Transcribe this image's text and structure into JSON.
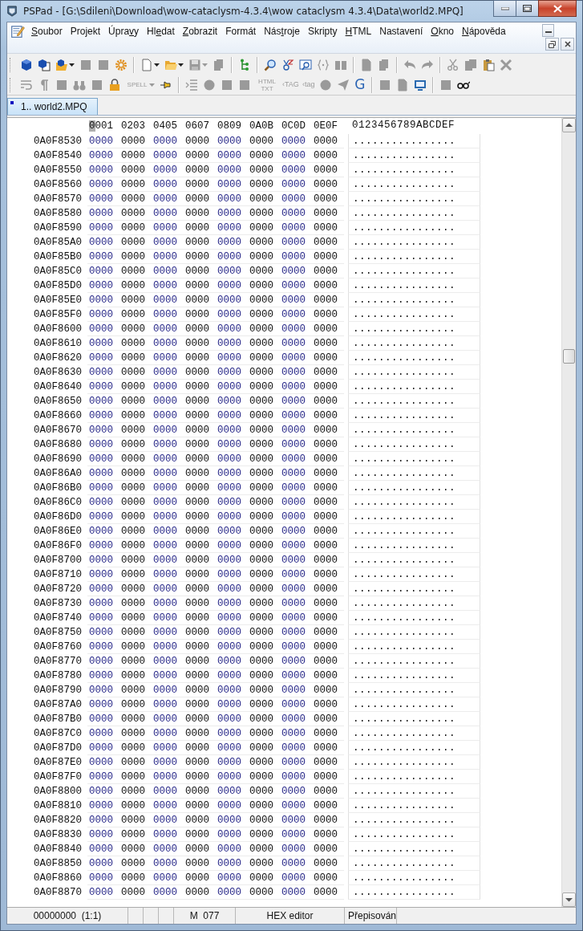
{
  "window": {
    "title": "PSPad - [G:\\Sdileni\\Download\\wow-cataclysm-4.3.4\\wow cataclysm 4.3.4\\Data\\world2.MPQ]"
  },
  "menu": [
    {
      "parts": [
        {
          "text": "S",
          "underlined": true
        },
        {
          "text": "oubor",
          "underlined": false
        }
      ]
    },
    {
      "parts": [
        {
          "text": "Projekt",
          "underlined": false
        }
      ]
    },
    {
      "parts": [
        {
          "text": "Úpra",
          "underlined": false
        },
        {
          "text": "v",
          "underlined": true
        },
        {
          "text": "y",
          "underlined": false
        }
      ]
    },
    {
      "parts": [
        {
          "text": "Hl",
          "underlined": false
        },
        {
          "text": "e",
          "underlined": true
        },
        {
          "text": "dat",
          "underlined": false
        }
      ]
    },
    {
      "parts": [
        {
          "text": "Z",
          "underlined": true
        },
        {
          "text": "obrazit",
          "underlined": false
        }
      ]
    },
    {
      "parts": [
        {
          "text": "Formát",
          "underlined": false
        }
      ]
    },
    {
      "parts": [
        {
          "text": "Nás",
          "underlined": false
        },
        {
          "text": "t",
          "underlined": true
        },
        {
          "text": "roje",
          "underlined": false
        }
      ]
    },
    {
      "parts": [
        {
          "text": "Skripty",
          "underlined": false
        }
      ]
    },
    {
      "parts": [
        {
          "text": "H",
          "underlined": true
        },
        {
          "text": "TML",
          "underlined": false
        }
      ]
    },
    {
      "parts": [
        {
          "text": "Nastavení",
          "underlined": false
        }
      ]
    },
    {
      "parts": [
        {
          "text": "O",
          "underlined": true
        },
        {
          "text": "kno",
          "underlined": false
        }
      ]
    },
    {
      "parts": [
        {
          "text": "N",
          "underlined": true
        },
        {
          "text": "ápověda",
          "underlined": false
        }
      ]
    }
  ],
  "toolbars": [
    [
      {
        "kind": "button",
        "disabled": false
      },
      {
        "kind": "button",
        "disabled": false
      },
      {
        "kind": "dropdown",
        "disabled": false
      },
      {
        "kind": "button",
        "disabled": true
      },
      {
        "kind": "button",
        "disabled": true
      },
      {
        "kind": "button",
        "disabled": false
      },
      {
        "kind": "separator"
      },
      {
        "kind": "dropdown",
        "disabled": false
      },
      {
        "kind": "dropdown",
        "disabled": false
      },
      {
        "kind": "dropdown",
        "disabled": true
      },
      {
        "kind": "button",
        "disabled": true
      },
      {
        "kind": "separator"
      },
      {
        "kind": "button",
        "disabled": false
      },
      {
        "kind": "separator"
      },
      {
        "kind": "button",
        "disabled": false
      },
      {
        "kind": "button",
        "disabled": false
      },
      {
        "kind": "button",
        "disabled": false
      },
      {
        "kind": "button",
        "disabled": true
      },
      {
        "kind": "button",
        "disabled": true
      },
      {
        "kind": "separator"
      },
      {
        "kind": "button",
        "disabled": true
      },
      {
        "kind": "button",
        "disabled": true
      },
      {
        "kind": "separator"
      },
      {
        "kind": "button",
        "disabled": true
      },
      {
        "kind": "button",
        "disabled": true
      },
      {
        "kind": "separator"
      },
      {
        "kind": "button",
        "disabled": true
      },
      {
        "kind": "button",
        "disabled": true
      },
      {
        "kind": "button",
        "disabled": false
      },
      {
        "kind": "button",
        "disabled": true
      }
    ],
    [
      {
        "kind": "button",
        "disabled": true
      },
      {
        "kind": "button",
        "disabled": true
      },
      {
        "kind": "button",
        "disabled": true
      },
      {
        "kind": "button",
        "disabled": true
      },
      {
        "kind": "button",
        "disabled": true
      },
      {
        "kind": "button",
        "disabled": false
      },
      {
        "kind": "text-dropdown",
        "label": "SPELL",
        "disabled": true
      },
      {
        "kind": "button",
        "disabled": false
      },
      {
        "kind": "separator"
      },
      {
        "kind": "button",
        "disabled": true
      },
      {
        "kind": "button",
        "disabled": true
      },
      {
        "kind": "button",
        "disabled": true
      },
      {
        "kind": "button",
        "disabled": true
      },
      {
        "kind": "text",
        "label": "HTML TXT",
        "disabled": true
      },
      {
        "kind": "text",
        "label": "‹TAG",
        "disabled": true
      },
      {
        "kind": "text",
        "label": "‹tag",
        "disabled": true
      },
      {
        "kind": "button",
        "disabled": true
      },
      {
        "kind": "button",
        "disabled": true
      },
      {
        "kind": "text",
        "label": "G",
        "disabled": false
      },
      {
        "kind": "separator"
      },
      {
        "kind": "button",
        "disabled": true
      },
      {
        "kind": "button",
        "disabled": true
      },
      {
        "kind": "button",
        "disabled": false
      },
      {
        "kind": "separator"
      },
      {
        "kind": "button",
        "disabled": true
      },
      {
        "kind": "button",
        "disabled": false
      }
    ]
  ],
  "tabs": [
    {
      "label": "1.. world2.MPQ",
      "selected": true,
      "modified": true
    }
  ],
  "editor": {
    "columns": [
      {
        "label": "0001",
        "cursor": true
      },
      {
        "label": "0203",
        "cursor": false
      },
      {
        "label": "0405",
        "cursor": false
      },
      {
        "label": "0607",
        "cursor": false
      },
      {
        "label": "0809",
        "cursor": false
      },
      {
        "label": "0A0B",
        "cursor": false
      },
      {
        "label": "0C0D",
        "cursor": false
      },
      {
        "label": "0E0F",
        "cursor": false
      }
    ],
    "text_header": "0123456789ABCDEF",
    "rows": [
      {
        "address": "0A0F8530",
        "hex": [
          "0000",
          "0000",
          "0000",
          "0000",
          "0000",
          "0000",
          "0000",
          "0000"
        ],
        "text": "................"
      },
      {
        "address": "0A0F8540",
        "hex": [
          "0000",
          "0000",
          "0000",
          "0000",
          "0000",
          "0000",
          "0000",
          "0000"
        ],
        "text": "................"
      },
      {
        "address": "0A0F8550",
        "hex": [
          "0000",
          "0000",
          "0000",
          "0000",
          "0000",
          "0000",
          "0000",
          "0000"
        ],
        "text": "................"
      },
      {
        "address": "0A0F8560",
        "hex": [
          "0000",
          "0000",
          "0000",
          "0000",
          "0000",
          "0000",
          "0000",
          "0000"
        ],
        "text": "................"
      },
      {
        "address": "0A0F8570",
        "hex": [
          "0000",
          "0000",
          "0000",
          "0000",
          "0000",
          "0000",
          "0000",
          "0000"
        ],
        "text": "................"
      },
      {
        "address": "0A0F8580",
        "hex": [
          "0000",
          "0000",
          "0000",
          "0000",
          "0000",
          "0000",
          "0000",
          "0000"
        ],
        "text": "................"
      },
      {
        "address": "0A0F8590",
        "hex": [
          "0000",
          "0000",
          "0000",
          "0000",
          "0000",
          "0000",
          "0000",
          "0000"
        ],
        "text": "................"
      },
      {
        "address": "0A0F85A0",
        "hex": [
          "0000",
          "0000",
          "0000",
          "0000",
          "0000",
          "0000",
          "0000",
          "0000"
        ],
        "text": "................"
      },
      {
        "address": "0A0F85B0",
        "hex": [
          "0000",
          "0000",
          "0000",
          "0000",
          "0000",
          "0000",
          "0000",
          "0000"
        ],
        "text": "................"
      },
      {
        "address": "0A0F85C0",
        "hex": [
          "0000",
          "0000",
          "0000",
          "0000",
          "0000",
          "0000",
          "0000",
          "0000"
        ],
        "text": "................"
      },
      {
        "address": "0A0F85D0",
        "hex": [
          "0000",
          "0000",
          "0000",
          "0000",
          "0000",
          "0000",
          "0000",
          "0000"
        ],
        "text": "................"
      },
      {
        "address": "0A0F85E0",
        "hex": [
          "0000",
          "0000",
          "0000",
          "0000",
          "0000",
          "0000",
          "0000",
          "0000"
        ],
        "text": "................"
      },
      {
        "address": "0A0F85F0",
        "hex": [
          "0000",
          "0000",
          "0000",
          "0000",
          "0000",
          "0000",
          "0000",
          "0000"
        ],
        "text": "................"
      },
      {
        "address": "0A0F8600",
        "hex": [
          "0000",
          "0000",
          "0000",
          "0000",
          "0000",
          "0000",
          "0000",
          "0000"
        ],
        "text": "................"
      },
      {
        "address": "0A0F8610",
        "hex": [
          "0000",
          "0000",
          "0000",
          "0000",
          "0000",
          "0000",
          "0000",
          "0000"
        ],
        "text": "................"
      },
      {
        "address": "0A0F8620",
        "hex": [
          "0000",
          "0000",
          "0000",
          "0000",
          "0000",
          "0000",
          "0000",
          "0000"
        ],
        "text": "................"
      },
      {
        "address": "0A0F8630",
        "hex": [
          "0000",
          "0000",
          "0000",
          "0000",
          "0000",
          "0000",
          "0000",
          "0000"
        ],
        "text": "................"
      },
      {
        "address": "0A0F8640",
        "hex": [
          "0000",
          "0000",
          "0000",
          "0000",
          "0000",
          "0000",
          "0000",
          "0000"
        ],
        "text": "................"
      },
      {
        "address": "0A0F8650",
        "hex": [
          "0000",
          "0000",
          "0000",
          "0000",
          "0000",
          "0000",
          "0000",
          "0000"
        ],
        "text": "................"
      },
      {
        "address": "0A0F8660",
        "hex": [
          "0000",
          "0000",
          "0000",
          "0000",
          "0000",
          "0000",
          "0000",
          "0000"
        ],
        "text": "................"
      },
      {
        "address": "0A0F8670",
        "hex": [
          "0000",
          "0000",
          "0000",
          "0000",
          "0000",
          "0000",
          "0000",
          "0000"
        ],
        "text": "................"
      },
      {
        "address": "0A0F8680",
        "hex": [
          "0000",
          "0000",
          "0000",
          "0000",
          "0000",
          "0000",
          "0000",
          "0000"
        ],
        "text": "................"
      },
      {
        "address": "0A0F8690",
        "hex": [
          "0000",
          "0000",
          "0000",
          "0000",
          "0000",
          "0000",
          "0000",
          "0000"
        ],
        "text": "................"
      },
      {
        "address": "0A0F86A0",
        "hex": [
          "0000",
          "0000",
          "0000",
          "0000",
          "0000",
          "0000",
          "0000",
          "0000"
        ],
        "text": "................"
      },
      {
        "address": "0A0F86B0",
        "hex": [
          "0000",
          "0000",
          "0000",
          "0000",
          "0000",
          "0000",
          "0000",
          "0000"
        ],
        "text": "................"
      },
      {
        "address": "0A0F86C0",
        "hex": [
          "0000",
          "0000",
          "0000",
          "0000",
          "0000",
          "0000",
          "0000",
          "0000"
        ],
        "text": "................"
      },
      {
        "address": "0A0F86D0",
        "hex": [
          "0000",
          "0000",
          "0000",
          "0000",
          "0000",
          "0000",
          "0000",
          "0000"
        ],
        "text": "................"
      },
      {
        "address": "0A0F86E0",
        "hex": [
          "0000",
          "0000",
          "0000",
          "0000",
          "0000",
          "0000",
          "0000",
          "0000"
        ],
        "text": "................"
      },
      {
        "address": "0A0F86F0",
        "hex": [
          "0000",
          "0000",
          "0000",
          "0000",
          "0000",
          "0000",
          "0000",
          "0000"
        ],
        "text": "................"
      },
      {
        "address": "0A0F8700",
        "hex": [
          "0000",
          "0000",
          "0000",
          "0000",
          "0000",
          "0000",
          "0000",
          "0000"
        ],
        "text": "................"
      },
      {
        "address": "0A0F8710",
        "hex": [
          "0000",
          "0000",
          "0000",
          "0000",
          "0000",
          "0000",
          "0000",
          "0000"
        ],
        "text": "................"
      },
      {
        "address": "0A0F8720",
        "hex": [
          "0000",
          "0000",
          "0000",
          "0000",
          "0000",
          "0000",
          "0000",
          "0000"
        ],
        "text": "................"
      },
      {
        "address": "0A0F8730",
        "hex": [
          "0000",
          "0000",
          "0000",
          "0000",
          "0000",
          "0000",
          "0000",
          "0000"
        ],
        "text": "................"
      },
      {
        "address": "0A0F8740",
        "hex": [
          "0000",
          "0000",
          "0000",
          "0000",
          "0000",
          "0000",
          "0000",
          "0000"
        ],
        "text": "................"
      },
      {
        "address": "0A0F8750",
        "hex": [
          "0000",
          "0000",
          "0000",
          "0000",
          "0000",
          "0000",
          "0000",
          "0000"
        ],
        "text": "................"
      },
      {
        "address": "0A0F8760",
        "hex": [
          "0000",
          "0000",
          "0000",
          "0000",
          "0000",
          "0000",
          "0000",
          "0000"
        ],
        "text": "................"
      },
      {
        "address": "0A0F8770",
        "hex": [
          "0000",
          "0000",
          "0000",
          "0000",
          "0000",
          "0000",
          "0000",
          "0000"
        ],
        "text": "................"
      },
      {
        "address": "0A0F8780",
        "hex": [
          "0000",
          "0000",
          "0000",
          "0000",
          "0000",
          "0000",
          "0000",
          "0000"
        ],
        "text": "................"
      },
      {
        "address": "0A0F8790",
        "hex": [
          "0000",
          "0000",
          "0000",
          "0000",
          "0000",
          "0000",
          "0000",
          "0000"
        ],
        "text": "................"
      },
      {
        "address": "0A0F87A0",
        "hex": [
          "0000",
          "0000",
          "0000",
          "0000",
          "0000",
          "0000",
          "0000",
          "0000"
        ],
        "text": "................"
      },
      {
        "address": "0A0F87B0",
        "hex": [
          "0000",
          "0000",
          "0000",
          "0000",
          "0000",
          "0000",
          "0000",
          "0000"
        ],
        "text": "................"
      },
      {
        "address": "0A0F87C0",
        "hex": [
          "0000",
          "0000",
          "0000",
          "0000",
          "0000",
          "0000",
          "0000",
          "0000"
        ],
        "text": "................"
      },
      {
        "address": "0A0F87D0",
        "hex": [
          "0000",
          "0000",
          "0000",
          "0000",
          "0000",
          "0000",
          "0000",
          "0000"
        ],
        "text": "................"
      },
      {
        "address": "0A0F87E0",
        "hex": [
          "0000",
          "0000",
          "0000",
          "0000",
          "0000",
          "0000",
          "0000",
          "0000"
        ],
        "text": "................"
      },
      {
        "address": "0A0F87F0",
        "hex": [
          "0000",
          "0000",
          "0000",
          "0000",
          "0000",
          "0000",
          "0000",
          "0000"
        ],
        "text": "................"
      },
      {
        "address": "0A0F8800",
        "hex": [
          "0000",
          "0000",
          "0000",
          "0000",
          "0000",
          "0000",
          "0000",
          "0000"
        ],
        "text": "................"
      },
      {
        "address": "0A0F8810",
        "hex": [
          "0000",
          "0000",
          "0000",
          "0000",
          "0000",
          "0000",
          "0000",
          "0000"
        ],
        "text": "................"
      },
      {
        "address": "0A0F8820",
        "hex": [
          "0000",
          "0000",
          "0000",
          "0000",
          "0000",
          "0000",
          "0000",
          "0000"
        ],
        "text": "................"
      },
      {
        "address": "0A0F8830",
        "hex": [
          "0000",
          "0000",
          "0000",
          "0000",
          "0000",
          "0000",
          "0000",
          "0000"
        ],
        "text": "................"
      },
      {
        "address": "0A0F8840",
        "hex": [
          "0000",
          "0000",
          "0000",
          "0000",
          "0000",
          "0000",
          "0000",
          "0000"
        ],
        "text": "................"
      },
      {
        "address": "0A0F8850",
        "hex": [
          "0000",
          "0000",
          "0000",
          "0000",
          "0000",
          "0000",
          "0000",
          "0000"
        ],
        "text": "................"
      },
      {
        "address": "0A0F8860",
        "hex": [
          "0000",
          "0000",
          "0000",
          "0000",
          "0000",
          "0000",
          "0000",
          "0000"
        ],
        "text": "................"
      },
      {
        "address": "0A0F8870",
        "hex": [
          "0000",
          "0000",
          "0000",
          "0000",
          "0000",
          "0000",
          "0000",
          "0000"
        ],
        "text": "................"
      }
    ]
  },
  "status_bar": {
    "position": "00000000  (1:1)",
    "mode": "M  077",
    "editor_kind": "HEX editor",
    "insert_mode": "Přepisován"
  }
}
